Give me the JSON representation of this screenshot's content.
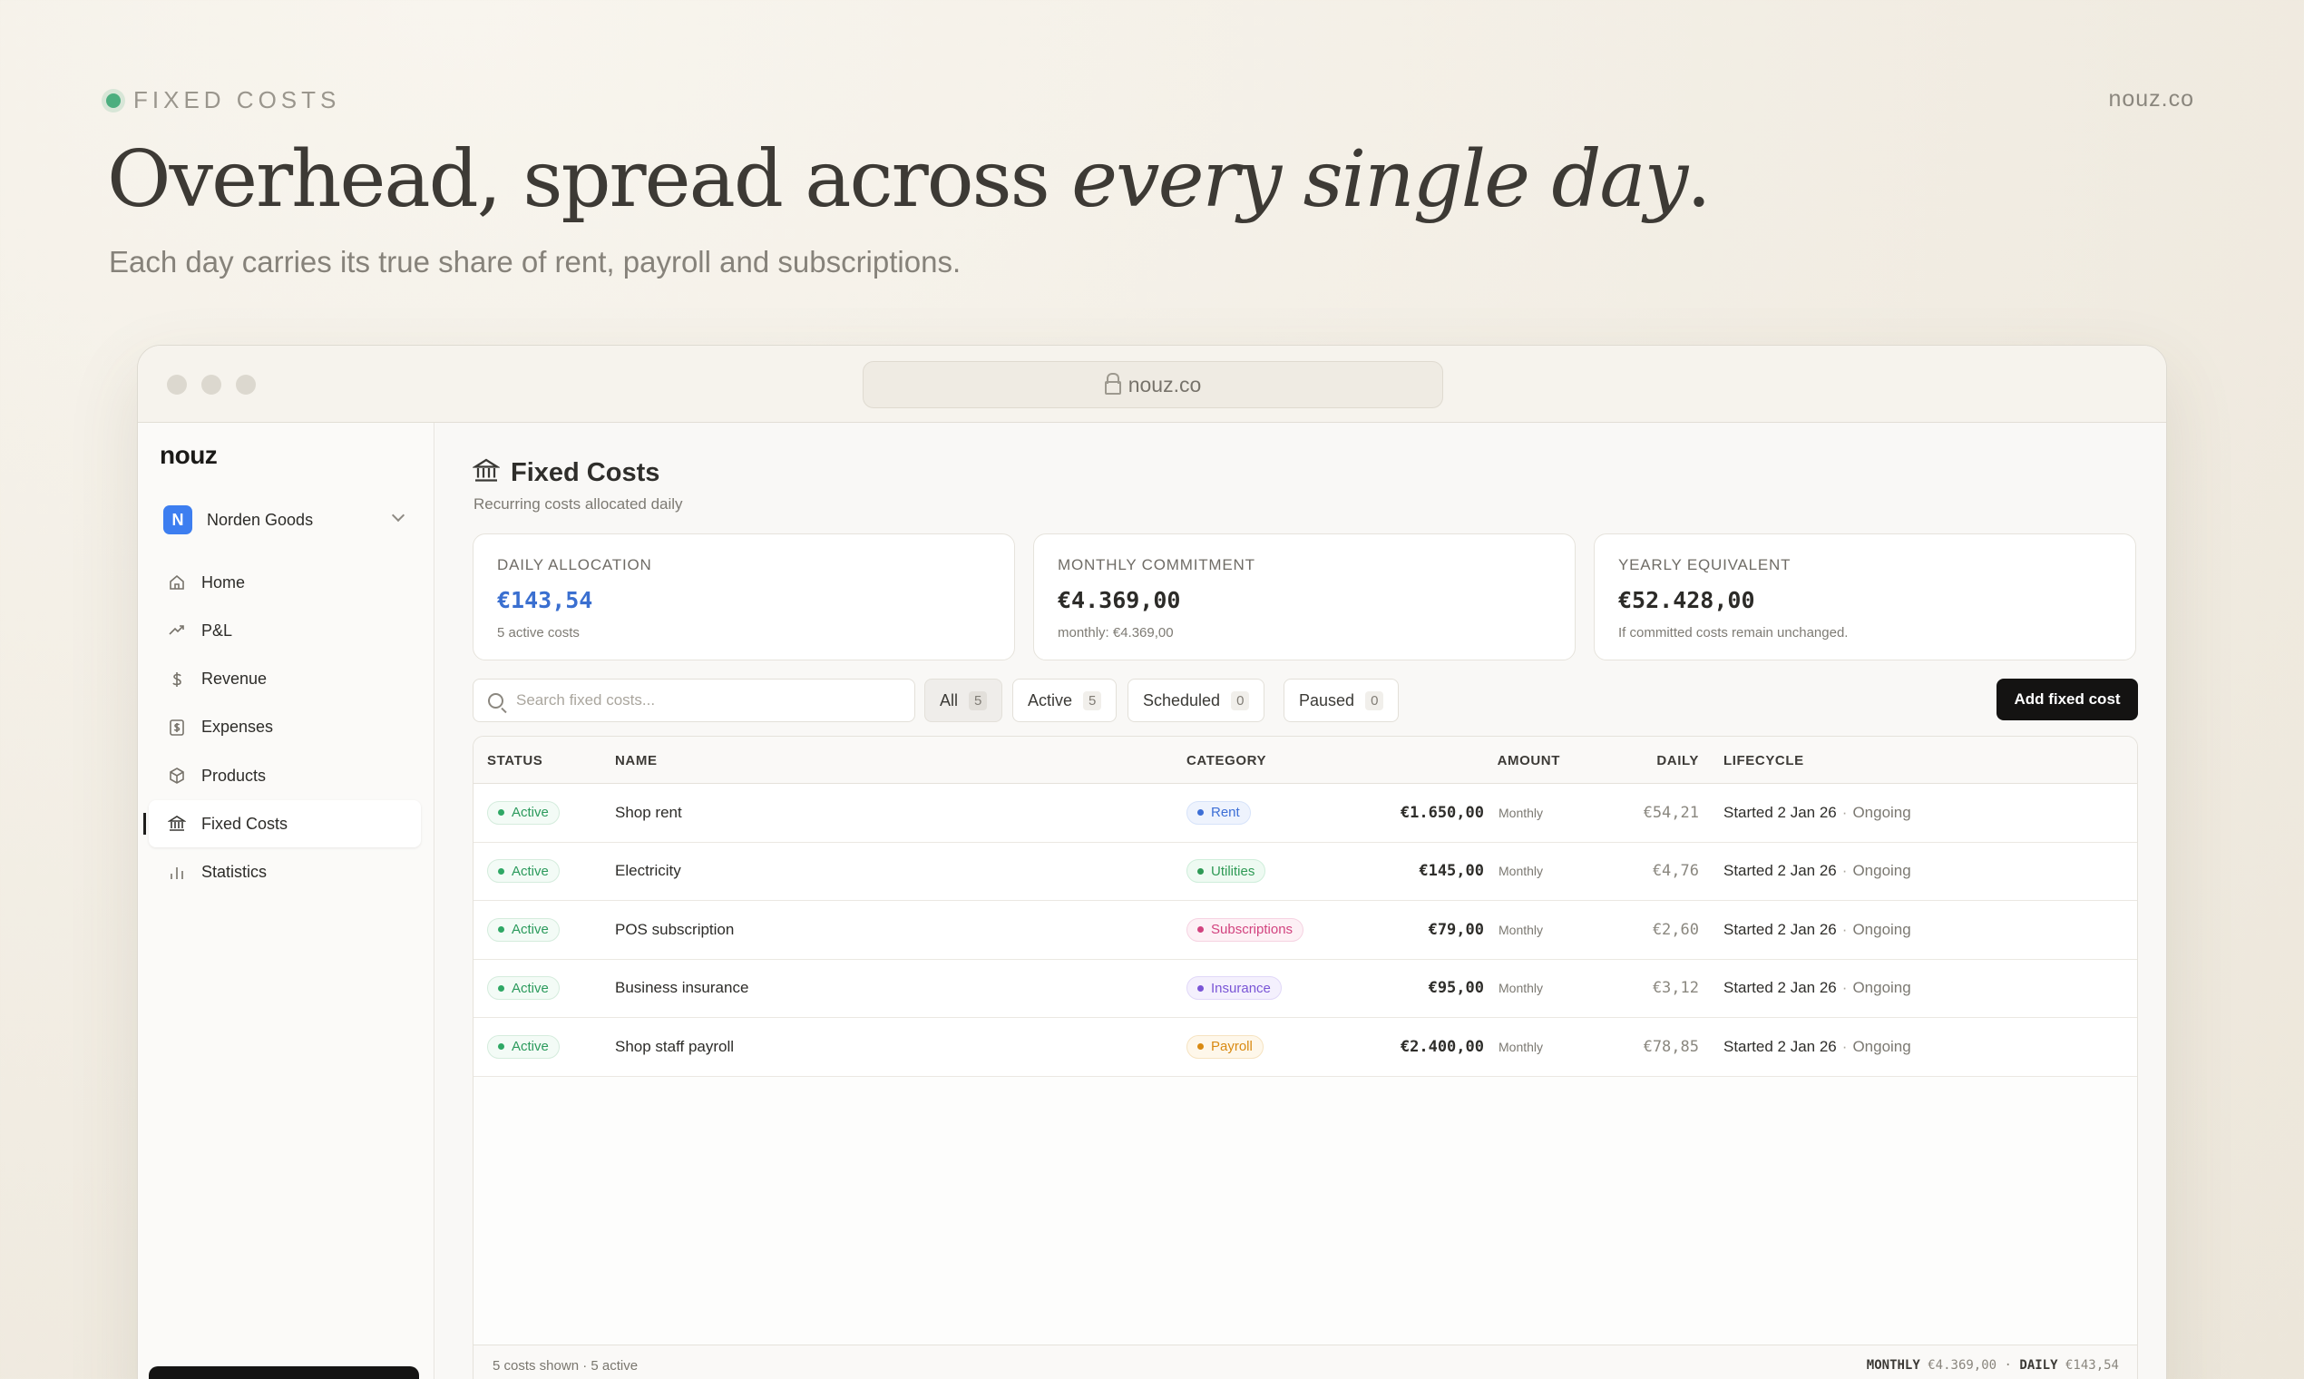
{
  "hero": {
    "eyebrow": "FIXED COSTS",
    "domain": "nouz.co",
    "title_main": "Overhead, spread across ",
    "title_emph": "every single day",
    "title_end": ".",
    "subtitle": "Each day carries its true share of rent, payroll and subscriptions."
  },
  "browser": {
    "url": "nouz.co"
  },
  "sidebar": {
    "logo": "nouz",
    "workspace_initial": "N",
    "workspace_name": "Norden Goods",
    "items": [
      {
        "label": "Home",
        "icon": "home-icon"
      },
      {
        "label": "P&L",
        "icon": "trend-icon"
      },
      {
        "label": "Revenue",
        "icon": "dollar-icon"
      },
      {
        "label": "Expenses",
        "icon": "receipt-icon"
      },
      {
        "label": "Products",
        "icon": "box-icon"
      },
      {
        "label": "Fixed Costs",
        "icon": "bank-icon"
      },
      {
        "label": "Statistics",
        "icon": "bar-chart-icon"
      }
    ]
  },
  "page": {
    "title": "Fixed Costs",
    "subtitle": "Recurring costs allocated daily"
  },
  "stats": [
    {
      "label": "DAILY ALLOCATION",
      "value": "€143,54",
      "note": "5 active costs"
    },
    {
      "label": "MONTHLY COMMITMENT",
      "value": "€4.369,00",
      "note": "monthly: €4.369,00"
    },
    {
      "label": "YEARLY EQUIVALENT",
      "value": "€52.428,00",
      "note": "If committed costs remain unchanged."
    }
  ],
  "filters": {
    "search_placeholder": "Search fixed costs...",
    "chips": [
      {
        "label": "All",
        "count": "5"
      },
      {
        "label": "Active",
        "count": "5"
      },
      {
        "label": "Scheduled",
        "count": "0"
      },
      {
        "label": "Paused",
        "count": "0"
      }
    ],
    "add_label": "Add fixed cost"
  },
  "table": {
    "headers": [
      "STATUS",
      "NAME",
      "CATEGORY",
      "AMOUNT",
      "DAILY",
      "LIFECYCLE"
    ],
    "rows": [
      {
        "status": "Active",
        "name": "Shop rent",
        "category": "Rent",
        "amount": "€1.650,00",
        "freq": "Monthly",
        "daily": "€54,21",
        "started": "Started 2 Jan 26",
        "ongoing": "Ongoing"
      },
      {
        "status": "Active",
        "name": "Electricity",
        "category": "Utilities",
        "amount": "€145,00",
        "freq": "Monthly",
        "daily": "€4,76",
        "started": "Started 2 Jan 26",
        "ongoing": "Ongoing"
      },
      {
        "status": "Active",
        "name": "POS subscription",
        "category": "Subscriptions",
        "amount": "€79,00",
        "freq": "Monthly",
        "daily": "€2,60",
        "started": "Started 2 Jan 26",
        "ongoing": "Ongoing"
      },
      {
        "status": "Active",
        "name": "Business insurance",
        "category": "Insurance",
        "amount": "€95,00",
        "freq": "Monthly",
        "daily": "€3,12",
        "started": "Started 2 Jan 26",
        "ongoing": "Ongoing"
      },
      {
        "status": "Active",
        "name": "Shop staff payroll",
        "category": "Payroll",
        "amount": "€2.400,00",
        "freq": "Monthly",
        "daily": "€78,85",
        "started": "Started 2 Jan 26",
        "ongoing": "Ongoing"
      }
    ],
    "footer_left": "5 costs shown · 5 active",
    "footer_monthly_label": "MONTHLY",
    "footer_monthly_value": "€4.369,00",
    "footer_daily_label": "DAILY",
    "footer_daily_value": "€143,54"
  },
  "colors": {
    "accent_blue": "#3a6fd0",
    "status_green": "#2fa865",
    "rent": "#3d6fd6",
    "utilities": "#2e9a55",
    "subscriptions": "#d2437f",
    "insurance": "#7a55d6",
    "payroll": "#d98a12"
  }
}
